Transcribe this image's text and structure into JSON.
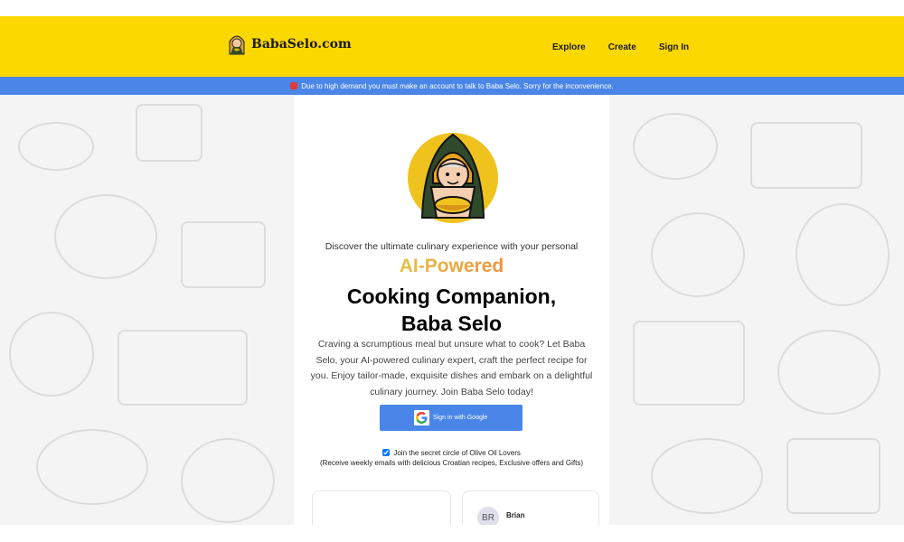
{
  "header": {
    "logo_text": "BabaSelo.com",
    "nav": [
      "Explore",
      "Create",
      "Sign In"
    ]
  },
  "banner": {
    "icon": "warning-icon",
    "text": "Due to high demand you must make an account to talk to Baba Selo. Sorry for the inconvenience."
  },
  "hero": {
    "intro": "Discover the ultimate culinary experience with your personal",
    "highlight": "AI-Powered",
    "title_line1": "Cooking Companion,",
    "title_line2": "Baba Selo",
    "description": "Craving a scrumptious meal but unsure what to cook? Let Baba Selo, your AI-powered culinary expert, craft the perfect recipe for you. Enjoy tailor-made, exquisite dishes and embark on a delightful culinary journey. Join Baba Selo today!"
  },
  "signin": {
    "label": "Sign in with Google",
    "icon": "google-icon"
  },
  "optin": {
    "checked": true,
    "label": "Join the secret circle of Olive Oil Lovers",
    "sublabel": "(Receive weekly emails with delicious Croatian recipes, Exclusive offers and Gifts)"
  },
  "testimonials": [
    {
      "initials": "",
      "name": ""
    },
    {
      "initials": "BR",
      "name": "Brian"
    }
  ],
  "colors": {
    "header": "#fcd801",
    "banner": "#4a86e8",
    "button": "#4a86e8"
  }
}
